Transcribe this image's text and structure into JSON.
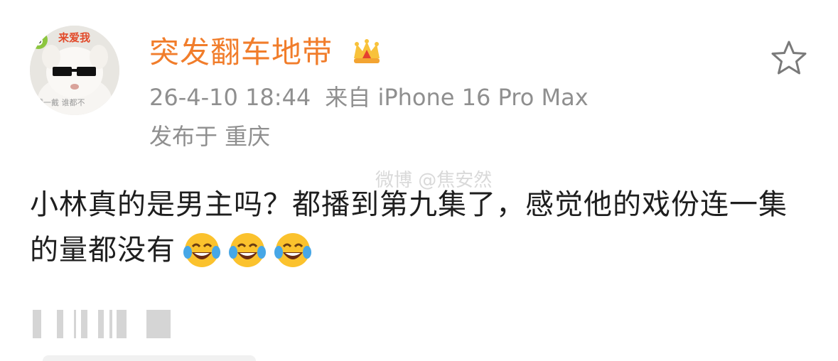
{
  "post": {
    "username": "突发翻车地带",
    "timestamp": "26-4-10 18:44",
    "source": "来自 iPhone 16 Pro Max",
    "location": "发布于 重庆",
    "content": "小林真的是男主吗？都播到第九集了，感觉他的戏份连一集的量都没有",
    "emojis": [
      "laughing-tears",
      "laughing-tears",
      "laughing-tears"
    ],
    "watermark": "微博 @焦安然"
  },
  "avatar": {
    "sticker_text": "来爱我",
    "caption": "镜一戴 谁都不"
  },
  "colors": {
    "username": "#f17d2b",
    "meta": "#8f8f8f",
    "content": "#1e1e1e"
  }
}
